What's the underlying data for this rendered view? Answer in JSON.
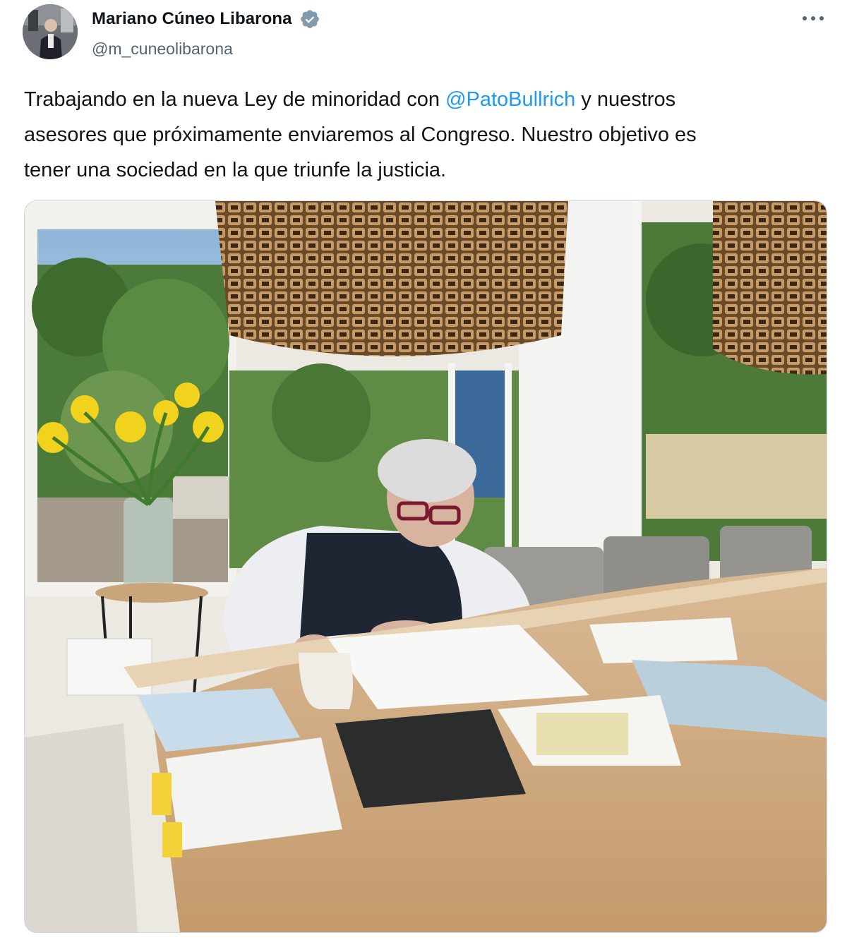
{
  "author": {
    "name": "Mariano Cúneo Libarona",
    "handle": "@m_cuneolibarona",
    "verified": true,
    "verified_icon": "verified-badge-icon",
    "avatar_icon": "avatar"
  },
  "more_icon": "more-options-icon",
  "tweet": {
    "text_before": "Trabajando en la nueva Ley de minoridad con ",
    "mention": "@PatoBullrich",
    "text_after": " y nuestros\nasesores que próximamente enviaremos al Congreso. Nuestro objetivo es\ntener una sociedad en la que triunfe la justicia."
  },
  "colors": {
    "text": "#0f1419",
    "secondary": "#536471",
    "link": "#1d9bf0",
    "verified": "#829aab"
  },
  "media": {
    "type": "photo",
    "icon": "photo-man-writing-at-table"
  }
}
